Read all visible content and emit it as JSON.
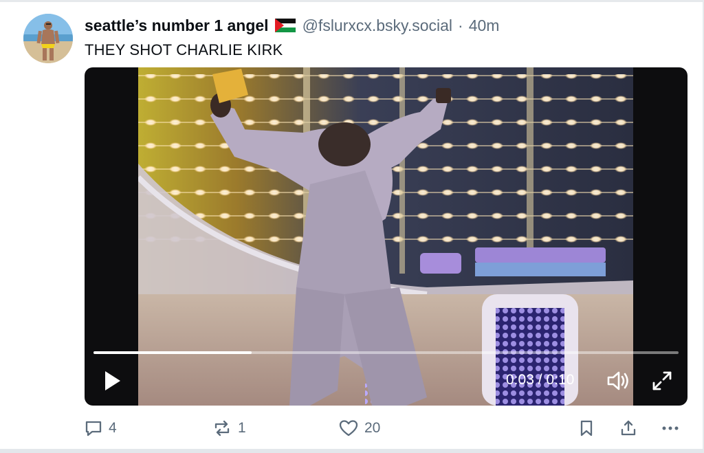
{
  "post": {
    "display_name": "seattle’s number 1 angel",
    "flag_icon": "palestine-flag-icon",
    "handle": "@fslurxcx.bsky.social",
    "separator": "·",
    "time": "40m",
    "text": "THEY SHOT CHARLIE KIRK"
  },
  "video": {
    "current_time": "0:03",
    "time_separator": " / ",
    "duration": "0:10",
    "progress": 0.27,
    "icons": {
      "play": "play-icon",
      "mute": "speaker-icon",
      "fullscreen": "fullscreen-icon"
    }
  },
  "actions": {
    "reply_count": "4",
    "repost_count": "1",
    "like_count": "20",
    "icons": [
      "reply-icon",
      "repost-icon",
      "like-icon",
      "bookmark-icon",
      "share-icon",
      "more-icon"
    ]
  },
  "colors": {
    "text_primary": "#0b0f14",
    "text_secondary": "#5b6b7b",
    "video_background": "#0d0d0f"
  }
}
